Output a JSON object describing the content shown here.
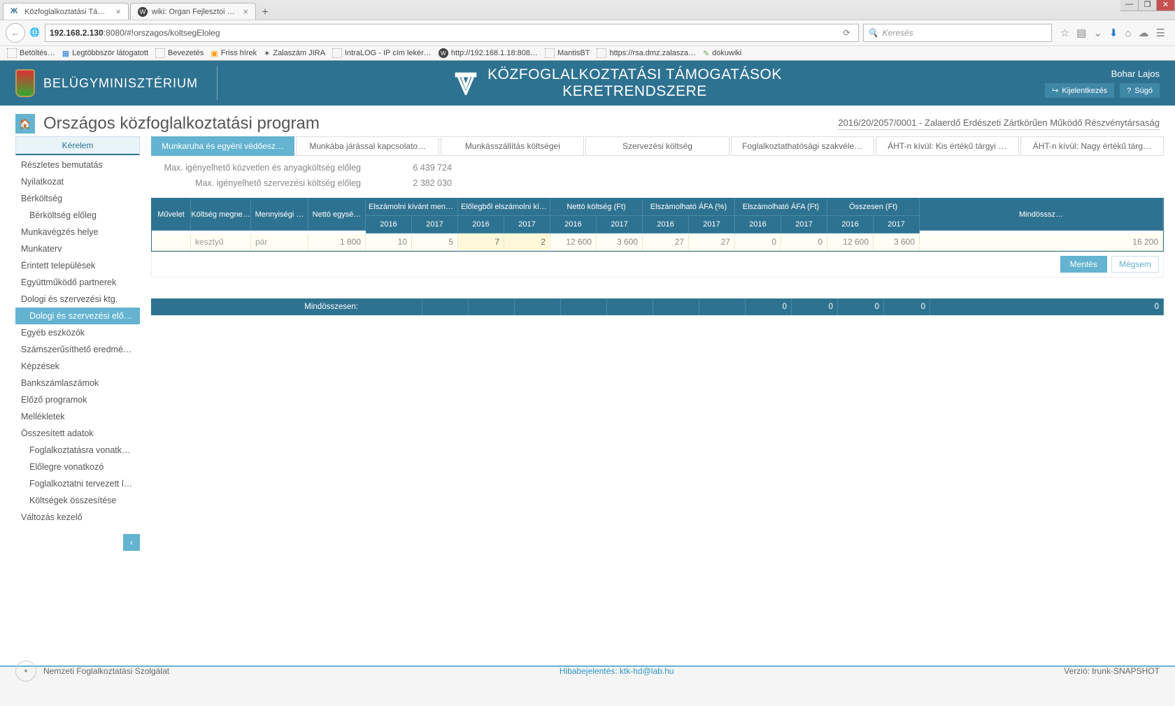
{
  "browser": {
    "tabs": [
      {
        "title": "Közfoglalkoztatási Támog…",
        "active": true
      },
      {
        "title": "wiki: Organ Fejlesztoi Szer…",
        "active": false
      }
    ],
    "url_prefix": "192.168.2.130",
    "url_port": ":8080",
    "url_path": "/#!orszagos/koltsegEloleg",
    "search_placeholder": "Keresés",
    "bookmarks": [
      "Betöltés…",
      "Legtöbbször látogatott",
      "Bevezetés",
      "Friss hírek",
      "Zalaszám JIRA",
      "IntraLOG - IP cím lekér…",
      "http://192.168.1.18:808…",
      "MantisBT",
      "https://rsa.dmz.zalasza…",
      "dokuwiki"
    ]
  },
  "header": {
    "ministry": "BELÜGYMINISZTÉRIUM",
    "system_line1": "KÖZFOGLALKOZTATÁSI TÁMOGATÁSOK",
    "system_line2": "KERETRENDSZERE",
    "user": "Bohar Lajos",
    "logout": "Kijelentkezés",
    "help": "Súgó"
  },
  "page": {
    "title": "Országos közfoglalkoztatási program",
    "context": "2016/20/2057/0001 - Zalaerdő Erdészeti Zártkörűen Működő Részvénytársaság"
  },
  "sidebar": {
    "tab": "Kérelem",
    "items": [
      {
        "label": "Részletes bemutatás"
      },
      {
        "label": "Nyilatkozat"
      },
      {
        "label": "Bérköltség"
      },
      {
        "label": "Bérköltség előleg",
        "sub": true
      },
      {
        "label": "Munkavégzés helye"
      },
      {
        "label": "Munkaterv"
      },
      {
        "label": "Érintett települések"
      },
      {
        "label": "Együttműködő partnerek"
      },
      {
        "label": "Dologi és szervezési ktg."
      },
      {
        "label": "Dologi és szervezési előleg",
        "sub": true,
        "active": true
      },
      {
        "label": "Egyéb eszközök"
      },
      {
        "label": "Számszerűsíthető eredmény…"
      },
      {
        "label": "Képzések"
      },
      {
        "label": "Bankszámlaszámok"
      },
      {
        "label": "Előző programok"
      },
      {
        "label": "Mellékletek"
      },
      {
        "label": "Összesített adatok"
      },
      {
        "label": "Foglalkoztatásra vonatkozó",
        "sub": true
      },
      {
        "label": "Előlegre vonatkozó",
        "sub": true
      },
      {
        "label": "Foglalkoztatni tervezett lét…",
        "sub": true
      },
      {
        "label": "Költségek összesítése",
        "sub": true
      },
      {
        "label": "Változás kezelő"
      }
    ]
  },
  "subtabs": [
    {
      "label": "Munkaruha és egyéni védőesz…",
      "active": true
    },
    {
      "label": "Munkába járással kapcsolato…"
    },
    {
      "label": "Munkásszállítás költségei"
    },
    {
      "label": "Szervezési költség"
    },
    {
      "label": "Foglalkoztathatósági szakvéle…"
    },
    {
      "label": "ÁHT-n kívül: Kis értékű tárgyi …"
    },
    {
      "label": "ÁHT-n kívül: Nagy értékű tárg…"
    }
  ],
  "maxlines": [
    {
      "label": "Max. igényelhető közvetlen és anyagköltség előleg",
      "value": "6 439 724"
    },
    {
      "label": "Max. igényelhető szervezési költség előleg",
      "value": "2 382 030"
    }
  ],
  "grid": {
    "head_top": {
      "op": "Művelet",
      "name": "Költség megne…",
      "unit": "Mennyiségi …",
      "price": "Nettó egysé…",
      "groups": [
        "Elszámolni kívánt menny…",
        "Előlegből elszámolni kívá…",
        "Nettó költség (Ft)",
        "Elszámolható ÁFA (%)",
        "Elszámolható ÁFA (Ft)",
        "Összesen (Ft)"
      ],
      "last": "Mindösssz…"
    },
    "years": [
      "2016",
      "2017"
    ],
    "row": {
      "name": "kesztyű",
      "unit": "pár",
      "price": "1 800",
      "qty": [
        "10",
        "5"
      ],
      "adv": [
        "7",
        "2"
      ],
      "net": [
        "12 600",
        "3 600"
      ],
      "vatp": [
        "27",
        "27"
      ],
      "vatf": [
        "0",
        "0"
      ],
      "tot": [
        "12 600",
        "3 600"
      ],
      "grand": "16 200"
    },
    "actions": {
      "save": "Mentés",
      "cancel": "Mégsem"
    },
    "totals": {
      "label": "Mindösszesen:",
      "values": [
        "",
        "",
        "",
        "",
        "",
        "",
        "",
        "",
        "0",
        "0",
        "0",
        "0",
        "0"
      ]
    }
  },
  "footer": {
    "org": "Nemzeti Foglalkoztatási Szolgálat",
    "bug": "Hibabejelentés: ktk-hd@lab.hu",
    "version": "Verzió: trunk-SNAPSHOT"
  }
}
